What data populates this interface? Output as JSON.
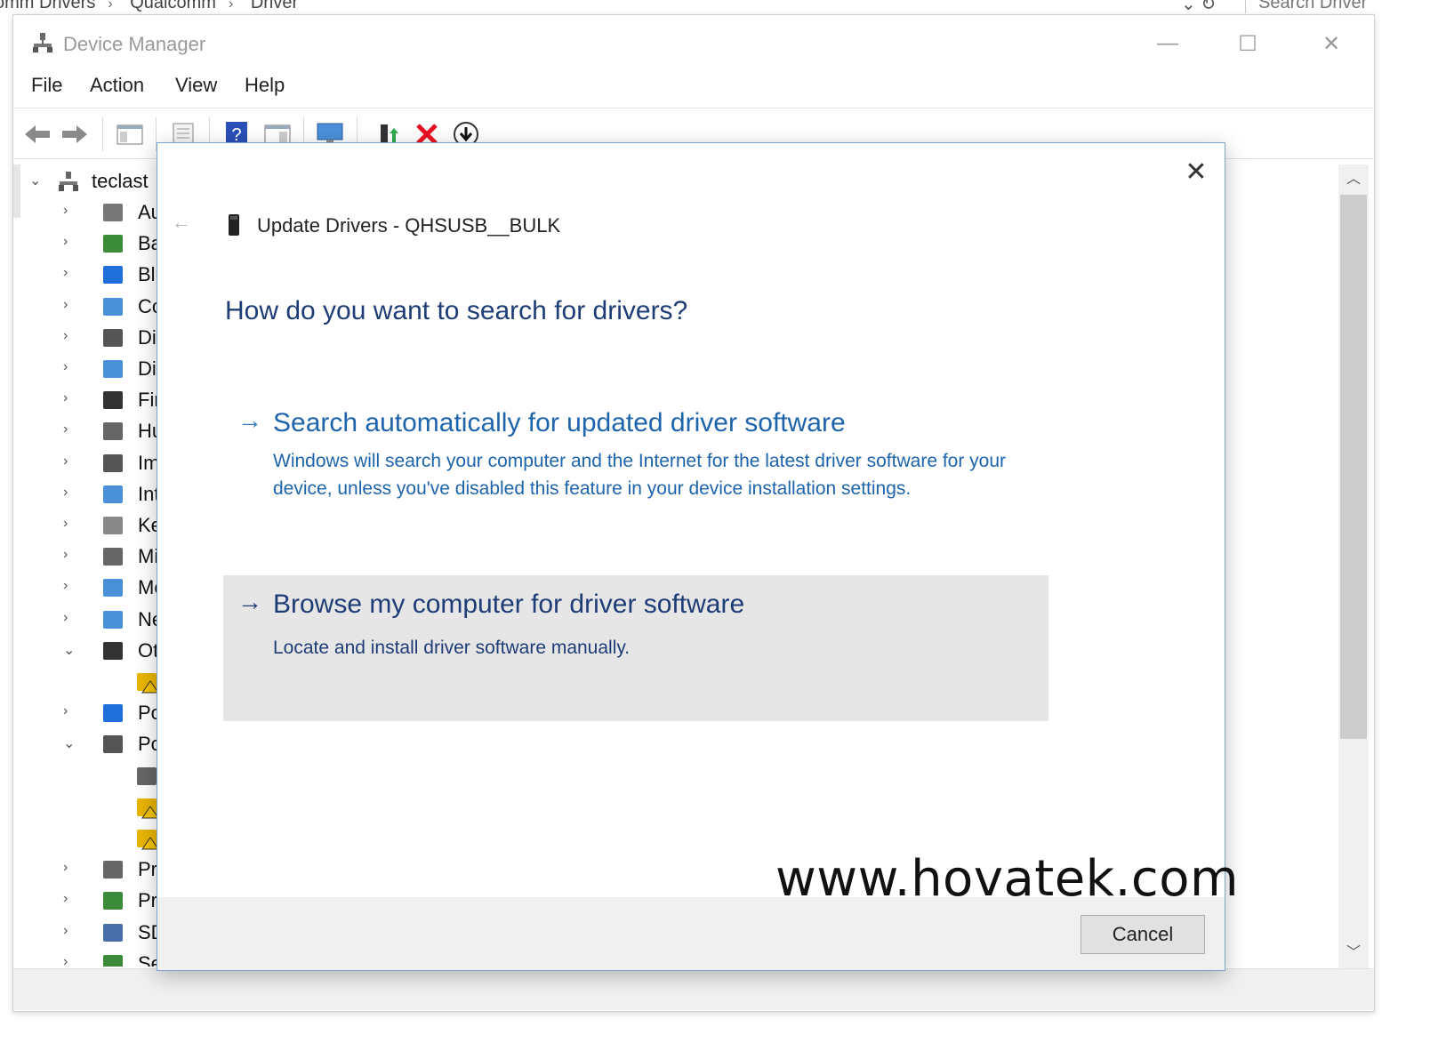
{
  "explorer": {
    "breadcrumbs": [
      "omm Drivers",
      "Qualcomm",
      "Driver"
    ],
    "search_placeholder": "Search Driver"
  },
  "window": {
    "title": "Device Manager",
    "menu": [
      "File",
      "Action",
      "View",
      "Help"
    ]
  },
  "toolbar": {
    "icons": [
      "back-icon",
      "forward-icon",
      "show-hide-tree-icon",
      "properties-icon",
      "help-icon",
      "view-details-icon",
      "scan-hardware-icon",
      "update-driver-icon",
      "uninstall-icon",
      "download-icon"
    ],
    "accent_red": "#e81123"
  },
  "tree": {
    "root": "teclast",
    "items": [
      {
        "label": "Auc",
        "icon": "speaker-icon",
        "expanded": false
      },
      {
        "label": "Bat",
        "icon": "battery-icon",
        "expanded": false
      },
      {
        "label": "Blu",
        "icon": "bluetooth-icon",
        "expanded": false
      },
      {
        "label": "Cor",
        "icon": "computer-icon",
        "expanded": false
      },
      {
        "label": "Disl",
        "icon": "disk-drive-icon",
        "expanded": false
      },
      {
        "label": "Dis",
        "icon": "display-adapter-icon",
        "expanded": false
      },
      {
        "label": "Firn",
        "icon": "firmware-icon",
        "expanded": false
      },
      {
        "label": "Hur",
        "icon": "hid-icon",
        "expanded": false
      },
      {
        "label": "Ima",
        "icon": "imaging-device-icon",
        "expanded": false
      },
      {
        "label": "Inte",
        "icon": "intel-icon",
        "expanded": false
      },
      {
        "label": "Key",
        "icon": "keyboard-icon",
        "expanded": false
      },
      {
        "label": "Mic",
        "icon": "mouse-icon",
        "expanded": false
      },
      {
        "label": "Mo",
        "icon": "monitor-icon",
        "expanded": false
      },
      {
        "label": "Net",
        "icon": "network-icon",
        "expanded": false
      },
      {
        "label": "Oth",
        "icon": "other-devices-icon",
        "expanded": true
      },
      {
        "label": "",
        "icon": "warning-device-icon",
        "child": true
      },
      {
        "label": "Por",
        "icon": "portable-device-icon",
        "expanded": false
      },
      {
        "label": "Por",
        "icon": "port-icon",
        "expanded": true
      },
      {
        "label": "",
        "icon": "port-child-icon",
        "child": true
      },
      {
        "label": "",
        "icon": "port-warning-icon",
        "child": true
      },
      {
        "label": "",
        "icon": "port-warning-icon",
        "child": true
      },
      {
        "label": "Prir",
        "icon": "printer-icon",
        "expanded": false
      },
      {
        "label": "Pro",
        "icon": "processor-icon",
        "expanded": false
      },
      {
        "label": "SD",
        "icon": "sd-host-icon",
        "expanded": false
      },
      {
        "label": "Sec",
        "icon": "security-icon",
        "expanded": false
      }
    ]
  },
  "dialog": {
    "title": "Update Drivers - QHSUSB__BULK",
    "question": "How do you want to search for drivers?",
    "options": [
      {
        "title": "Search automatically for updated driver software",
        "description": "Windows will search your computer and the Internet for the latest driver software for your device, unless you've disabled this feature in your device installation settings."
      },
      {
        "title": "Browse my computer for driver software",
        "description": "Locate and install driver software manually."
      }
    ],
    "cancel_label": "Cancel"
  },
  "watermark": "www.hovatek.com"
}
